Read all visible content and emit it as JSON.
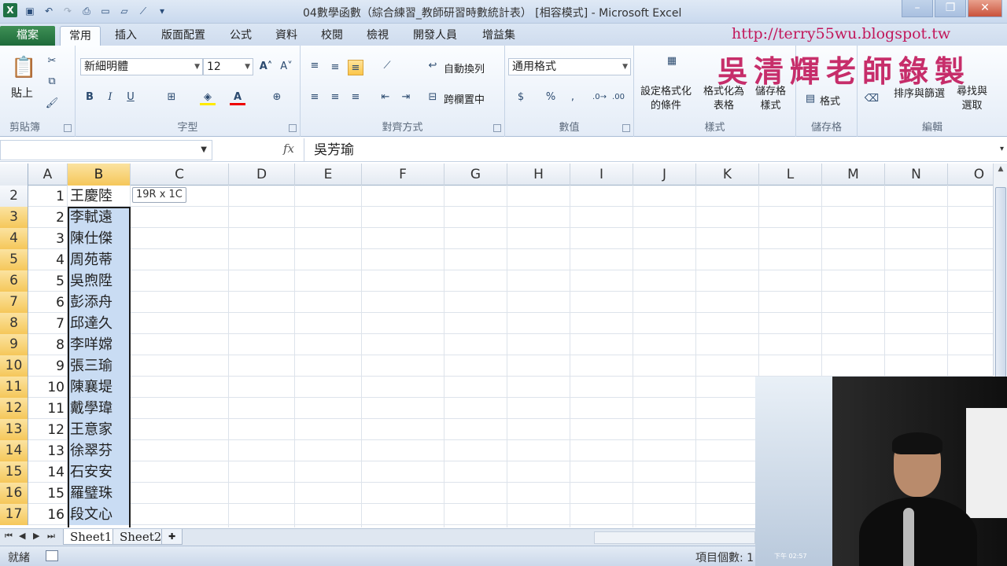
{
  "window": {
    "title": "04數學函數（綜合練習_教師研習時數統計表）  [相容模式] - Microsoft Excel",
    "app_icon": "X"
  },
  "quick_access": [
    "save-icon",
    "undo-icon",
    "redo-icon",
    "print-preview-icon",
    "new-icon",
    "open-icon",
    "chart-icon",
    "customize-icon"
  ],
  "tabs": {
    "file": "檔案",
    "items": [
      "常用",
      "插入",
      "版面配置",
      "公式",
      "資料",
      "校閱",
      "檢視",
      "開發人員",
      "增益集"
    ],
    "active": "常用"
  },
  "overlay": {
    "url": "http://terry55wu.blogspot.tw",
    "watermark": "吳清輝老師錄製"
  },
  "ribbon": {
    "clipboard": {
      "paste": "貼上",
      "label": "剪貼簿"
    },
    "font": {
      "name": "新細明體",
      "size": "12",
      "bold": "B",
      "italic": "I",
      "underline": "U",
      "label": "字型"
    },
    "alignment": {
      "wrap": "自動換列",
      "merge": "跨欄置中",
      "label": "對齊方式"
    },
    "number": {
      "format": "通用格式",
      "currency": "$",
      "percent": "%",
      "comma": ",",
      "label": "數值"
    },
    "styles": {
      "conditional": [
        "設定格式化",
        "的條件"
      ],
      "table": [
        "格式化為",
        "表格"
      ],
      "cell": [
        "儲存格",
        "樣式"
      ],
      "label": "樣式"
    },
    "cells": {
      "format": "格式",
      "label": "儲存格"
    },
    "editing": {
      "sort": "排序與篩選",
      "find": [
        "尋找與",
        "選取"
      ],
      "label": "編輯"
    }
  },
  "formula_bar": {
    "name_box": "",
    "fx": "fx",
    "content": "吳芳瑜"
  },
  "grid": {
    "columns": [
      "A",
      "B",
      "C",
      "D",
      "E",
      "F",
      "G",
      "H",
      "I",
      "J",
      "K",
      "L",
      "M",
      "N",
      "O"
    ],
    "selected_column": "B",
    "tooltip": "19R x 1C",
    "rows": [
      {
        "row": "2",
        "a": "1",
        "b": "王慶陸",
        "selected": false
      },
      {
        "row": "3",
        "a": "2",
        "b": "李軾遠",
        "selected": true
      },
      {
        "row": "4",
        "a": "3",
        "b": "陳仕傑",
        "selected": true
      },
      {
        "row": "5",
        "a": "4",
        "b": "周苑蒂",
        "selected": true
      },
      {
        "row": "6",
        "a": "5",
        "b": "吳煦陞",
        "selected": true
      },
      {
        "row": "7",
        "a": "6",
        "b": "彭添舟",
        "selected": true
      },
      {
        "row": "8",
        "a": "7",
        "b": "邱達久",
        "selected": true
      },
      {
        "row": "9",
        "a": "8",
        "b": "李咩嫦",
        "selected": true
      },
      {
        "row": "10",
        "a": "9",
        "b": "張三瑜",
        "selected": true
      },
      {
        "row": "11",
        "a": "10",
        "b": "陳襄堤",
        "selected": true
      },
      {
        "row": "12",
        "a": "11",
        "b": "戴學瑋",
        "selected": true
      },
      {
        "row": "13",
        "a": "12",
        "b": "王意家",
        "selected": true
      },
      {
        "row": "14",
        "a": "13",
        "b": "徐翠芬",
        "selected": true
      },
      {
        "row": "15",
        "a": "14",
        "b": "石安安",
        "selected": true
      },
      {
        "row": "16",
        "a": "15",
        "b": "羅璧珠",
        "selected": true
      },
      {
        "row": "17",
        "a": "16",
        "b": "段文心",
        "selected": true
      }
    ]
  },
  "sheets": {
    "tabs": [
      "Sheet1",
      "Sheet2"
    ],
    "active": "Sheet1"
  },
  "status": {
    "ready": "就緒",
    "count": "項目個數: 1"
  },
  "webcam": {
    "clock": "下午 02:57"
  }
}
